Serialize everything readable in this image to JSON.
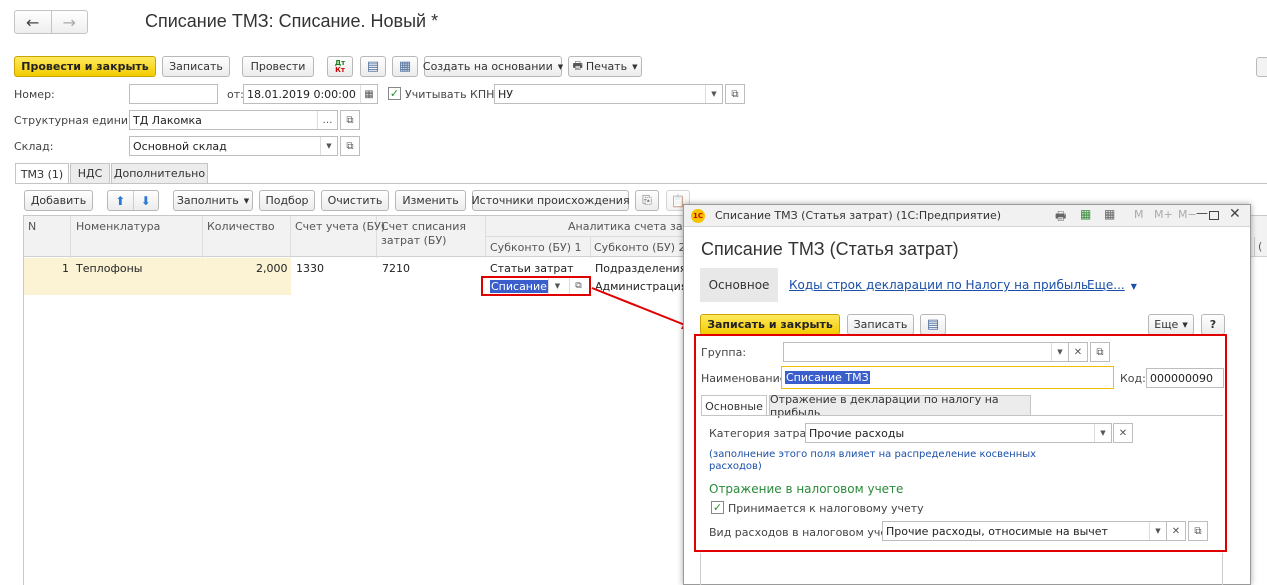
{
  "doc": {
    "title": "Списание ТМЗ: Списание. Новый *",
    "toolbar": {
      "post_close": "Провести и закрыть",
      "save": "Записать",
      "post": "Провести",
      "dt_kt": "Дт\nКт",
      "create_based": "Создать на основании",
      "print": "Печать"
    },
    "fields": {
      "number_label": "Номер:",
      "number_value": "",
      "from_label": "от:",
      "date_value": "18.01.2019  0:00:00",
      "kpn_label": "Учитывать КПН",
      "kpn_value": "НУ",
      "unit_label": "Структурная единица:",
      "unit_value": "ТД Лакомка",
      "warehouse_label": "Склад:",
      "warehouse_value": "Основной склад"
    },
    "tabs": [
      "ТМЗ (1)",
      "НДС",
      "Дополнительно"
    ],
    "table_toolbar": {
      "add": "Добавить",
      "fill": "Заполнить",
      "select": "Подбор",
      "clear": "Очистить",
      "change": "Изменить",
      "sources": "Источники происхождения"
    },
    "table": {
      "headers": {
        "n": "N",
        "item": "Номенклатура",
        "qty": "Количество",
        "account": "Счет учета (БУ)",
        "writeoff": "Счет списания затрат (БУ)",
        "analytics": "Аналитика счета затрат",
        "sub1": "Субконто (БУ) 1",
        "sub2": "Субконто (БУ) 2"
      },
      "row": {
        "n": "1",
        "item": "Теплофоны",
        "qty": "2,000",
        "account": "1330",
        "writeoff": "7210",
        "sub1_top": "Статьи затрат",
        "sub1_val": "Списание",
        "sub2_top": "Подразделения",
        "sub2_val": "Администрация"
      }
    }
  },
  "popup": {
    "window_title": "Списание ТМЗ (Статья затрат)  (1С:Предприятие)",
    "logo": "1С",
    "m_labels": [
      "M",
      "M+",
      "M−"
    ],
    "heading": "Списание ТМЗ (Статья затрат)",
    "nav_main": "Основное",
    "nav_codes": "Коды строк декларации по Налогу на прибыль",
    "nav_more": "Еще...",
    "save_close": "Записать и закрыть",
    "save": "Записать",
    "more": "Еще",
    "help": "?",
    "group_label": "Группа:",
    "group_value": "",
    "name_label": "Наименование:",
    "name_value": "Списание ТМЗ",
    "code_label": "Код:",
    "code_value": "000000090",
    "tabs": [
      "Основные",
      "Отражение в декларации по налогу на прибыль"
    ],
    "category_label": "Категория затрат:",
    "category_value": "Прочие расходы",
    "note": "(заполнение этого поля влияет на распределение косвенных расходов)",
    "section": "Отражение в налоговом учете",
    "tax_accept": "Принимается к налоговому учету",
    "expense_kind_label": "Вид расходов в налоговом учете:",
    "expense_kind_value": "Прочие расходы, относимые на вычет"
  },
  "colors": {
    "accent_yellow": "#f5d300",
    "highlight_red": "#e00000",
    "link": "#1a4fa8",
    "green": "#2a8a3a",
    "row_bg": "#fbf3d4"
  }
}
